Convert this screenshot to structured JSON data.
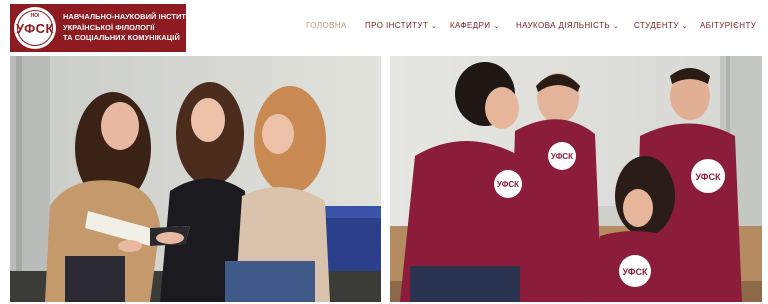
{
  "logo": {
    "mark_small": "НОІ",
    "mark_main": "УФСК",
    "lines": [
      "НАВЧАЛЬНО-НАУКОВИЙ ІНСТИТУТ",
      "УКРАЇНСЬКОЇ ФІЛОЛОГІЇ",
      "ТА СОЦІАЛЬНИХ КОМУНІКАЦІЙ"
    ]
  },
  "nav": {
    "items": [
      {
        "label": "ГОЛОВНА",
        "active": true,
        "dropdown": false
      },
      {
        "label": "ПРО ІНСТИТУТ",
        "active": false,
        "dropdown": true
      },
      {
        "label": "КАФЕДРИ",
        "active": false,
        "dropdown": true
      },
      {
        "label": "НАУКОВА ДІЯЛЬНІСТЬ",
        "active": false,
        "dropdown": true
      },
      {
        "label": "СТУДЕНТУ",
        "active": false,
        "dropdown": true
      },
      {
        "label": "АБІТУРІЄНТУ",
        "active": false,
        "dropdown": false
      }
    ],
    "chevron_icon": "chevron-down-icon"
  },
  "photos": {
    "shirt_logo": "УФСК"
  },
  "colors": {
    "brand": "#8e1b22",
    "nav_text": "#7a1f24",
    "nav_active": "#b7a07c",
    "shirt": "#8b1d3b"
  }
}
